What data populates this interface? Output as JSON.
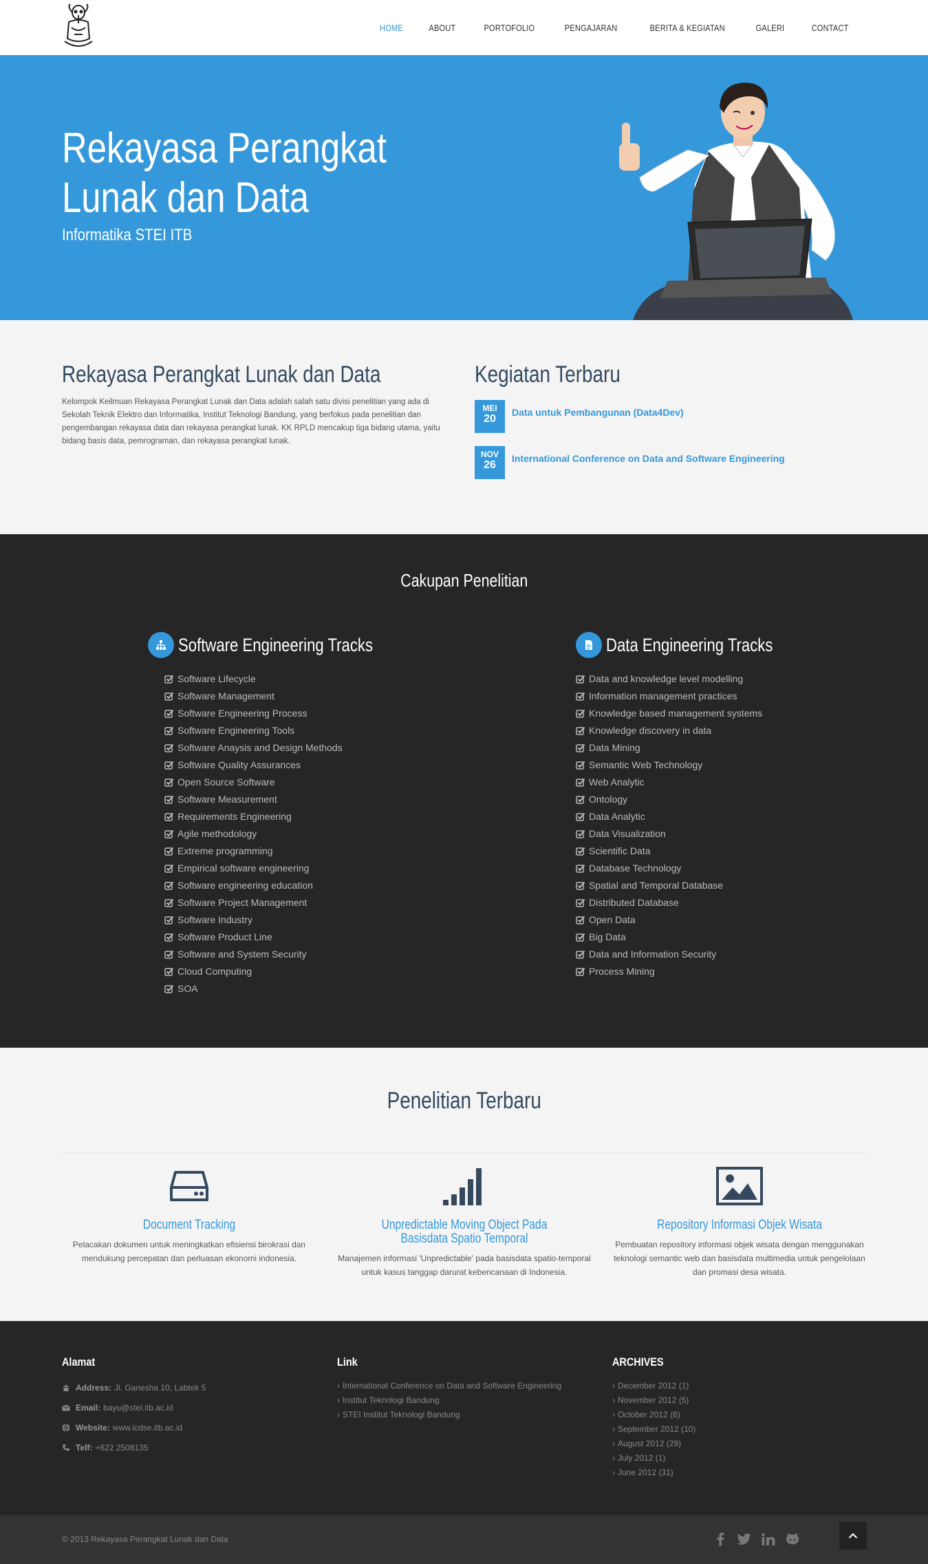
{
  "header": {
    "nav": [
      "HOME",
      "ABOUT",
      "PORTOFOLIO",
      "PENGAJARAN",
      "BERITA & KEGIATAN",
      "GALERI",
      "CONTACT"
    ],
    "active_nav": "HOME"
  },
  "hero": {
    "title": "Rekayasa Perangkat Lunak dan Data",
    "subtitle": "Informatika STEI ITB"
  },
  "intro": {
    "title": "Rekayasa Perangkat Lunak dan Data",
    "text": "Kelompok Keilmuan Rekayasa Perangkat Lunak dan Data adalah salah satu divisi penelitian yang ada di Sekolah Teknik Elektro dan Informatika, Institut Teknologi Bandung, yang berfokus pada penelitian dan pengembangan rekayasa data dan rekayasa perangkat lunak. KK RPLD mencakup tiga bidang utama, yaitu bidang basis data, pemrograman, dan rekayasa perangkat lunak."
  },
  "news": {
    "title": "Kegiatan Terbaru",
    "items": [
      {
        "month": "MEI",
        "day": "20",
        "title": "Data untuk Pembangunan (Data4Dev)"
      },
      {
        "month": "NOV",
        "day": "26",
        "title": "International Conference on Data and Software Engineering"
      }
    ]
  },
  "research": {
    "title": "Cakupan Penelitian",
    "software": {
      "title": "Software Engineering Tracks",
      "items": [
        "Software Lifecycle",
        "Software Management",
        "Software Engineering Process",
        "Software Engineering Tools",
        "Software Anaysis and Design Methods",
        "Software Quality Assurances",
        "Open Source Software",
        "Software Measurement",
        "Requirements Engineering",
        "Agile methodology",
        "Extreme programming",
        "Empirical software engineering",
        "Software engineering education",
        "Software Project Management",
        "Software Industry",
        "Software Product Line",
        "Software and System Security",
        "Cloud Computing",
        "SOA"
      ]
    },
    "data": {
      "title": "Data Engineering Tracks",
      "items": [
        "Data and knowledge level modelling",
        "Information management practices",
        "Knowledge based management systems",
        "Knowledge discovery in data",
        "Data Mining",
        "Semantic Web Technology",
        "Web Analytic",
        "Ontology",
        "Data Analytic",
        "Data Visualization",
        "Scientific Data",
        "Database Technology",
        "Spatial and Temporal Database",
        "Distributed Database",
        "Open Data",
        "Big Data",
        "Data and Information Security",
        "Process Mining"
      ]
    }
  },
  "latest": {
    "title": "Penelitian Terbaru",
    "items": [
      {
        "icon": "hdd-icon",
        "title": "Document Tracking",
        "desc": "Pelacakan dokumen untuk meningkatkan efisiensi birokrasi dan mendukung percepatan dan perluasan ekonomi indonesia."
      },
      {
        "icon": "signal-icon",
        "title": "Unpredictable Moving Object Pada Basisdata Spatio Temporal",
        "desc": "Manajemen informasi 'Unpredictable' pada basisdata spatio-temporal untuk kasus tanggap darurat kebencanaan di Indonesia."
      },
      {
        "icon": "picture-icon",
        "title": "Repository Informasi Objek Wisata",
        "desc": "Pembuatan repository informasi objek wisata dengan menggunakan teknologi semantic web dan basisdata multimedia untuk pengelolaan dan promasi desa wisata."
      }
    ]
  },
  "footer": {
    "alamat": {
      "title": "Alamat",
      "address_label": "Address:",
      "address": "Jl. Ganesha 10, Labtek 5",
      "email_label": "Email:",
      "email": "bayu@stei.itb.ac.id",
      "website_label": "Website:",
      "website": "www.icdse.itb.ac.id",
      "telp_label": "Telf:",
      "telp": "+622 2508135"
    },
    "link": {
      "title": "Link",
      "items": [
        "International Conference on Data and Software Engineering",
        "Institut Teknologi Bandung",
        "STEI Institut Teknologi Bandung"
      ]
    },
    "archives": {
      "title": "ARCHIVES",
      "items": [
        {
          "label": "December 2012",
          "count": "(1)"
        },
        {
          "label": "November 2012",
          "count": "(5)"
        },
        {
          "label": "October 2012",
          "count": "(8)"
        },
        {
          "label": "September 2012",
          "count": "(10)"
        },
        {
          "label": "August 2012",
          "count": "(29)"
        },
        {
          "label": "July 2012",
          "count": "(1)"
        },
        {
          "label": "June 2012",
          "count": "(31)"
        }
      ]
    },
    "copyright": "© 2013 Rekayasa Perangkat Lunak dan Data",
    "social": [
      "facebook-icon",
      "twitter-icon",
      "linkedin-icon",
      "github-icon"
    ]
  },
  "colors": {
    "accent": "#3498db",
    "dark": "#262626",
    "heading": "#34495e"
  }
}
